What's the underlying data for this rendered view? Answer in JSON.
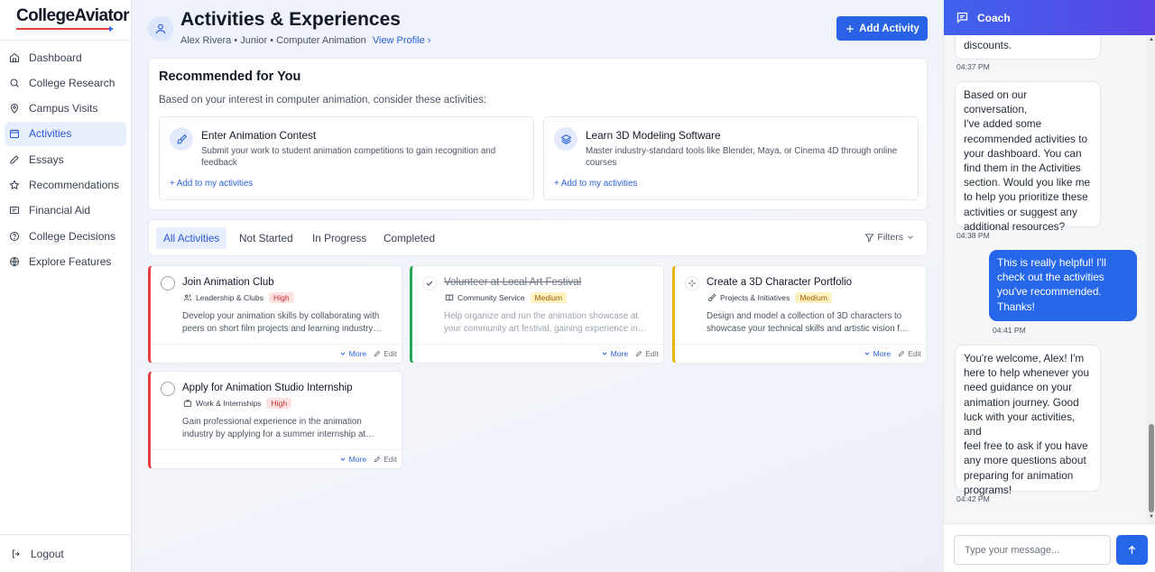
{
  "brand": {
    "name": "CollegeAviator"
  },
  "sidebar": {
    "items": [
      {
        "label": "Dashboard",
        "icon": "home-icon"
      },
      {
        "label": "College Research",
        "icon": "search-icon"
      },
      {
        "label": "Campus Visits",
        "icon": "map-pin-icon"
      },
      {
        "label": "Activities",
        "icon": "calendar-icon",
        "active": true
      },
      {
        "label": "Essays",
        "icon": "pencil-icon"
      },
      {
        "label": "Recommendations",
        "icon": "star-icon"
      },
      {
        "label": "Financial Aid",
        "icon": "dollar-icon"
      },
      {
        "label": "College Decisions",
        "icon": "help-circle-icon"
      },
      {
        "label": "Explore Features",
        "icon": "globe-icon"
      }
    ],
    "logout_label": "Logout"
  },
  "header": {
    "title": "Activities & Experiences",
    "subtitle": "Alex Rivera • Junior • Computer Animation",
    "view_profile": "View Profile",
    "add_button": "Add Activity"
  },
  "recommended": {
    "title": "Recommended for You",
    "subtitle": "Based on your interest in computer animation, consider these activities:",
    "cards": [
      {
        "title": "Enter Animation Contest",
        "description": "Submit your work to student animation competitions to gain recognition and feedback",
        "link": "+ Add to my activities",
        "icon": "brush-icon"
      },
      {
        "title": "Learn 3D Modeling Software",
        "description": "Master industry-standard tools like Blender, Maya, or Cinema 4D through online courses",
        "link": "+ Add to my activities",
        "icon": "layers-icon"
      }
    ]
  },
  "tabs": [
    "All Activities",
    "Not Started",
    "In Progress",
    "Completed"
  ],
  "filters_label": "Filters",
  "activities": [
    {
      "title": "Join Animation Club",
      "category": "Leadership & Clubs",
      "priority": "High",
      "description": "Develop your animation skills by collaborating with peers on short film projects and learning industry…",
      "status": "not-started",
      "accent": "#e53e3e"
    },
    {
      "title": "Volunteer at Local Art Festival",
      "category": "Community Service",
      "priority": "Medium",
      "description": "Help organize and run the animation showcase at your community art festival, gaining experience in…",
      "status": "completed",
      "accent": "#22a652"
    },
    {
      "title": "Create a 3D Character Portfolio",
      "category": "Projects & Initiatives",
      "priority": "Medium",
      "description": "Design and model a collection of 3D characters to showcase your technical skills and artistic vision f…",
      "status": "in-progress",
      "accent": "#eab308"
    },
    {
      "title": "Apply for Animation Studio Internship",
      "category": "Work & Internships",
      "priority": "High",
      "description": "Gain professional experience in the animation industry by applying for a summer internship at…",
      "status": "not-started",
      "accent": "#e53e3e"
    }
  ],
  "card_actions": {
    "more": "More",
    "edit": "Edit"
  },
  "coach": {
    "title": "Coach",
    "messages": [
      {
        "from": "coach",
        "lines": [
          "discounts."
        ],
        "time": "04:37 PM"
      },
      {
        "from": "coach",
        "lines": [
          "Based on our conversation,",
          "I've added some",
          "recommended activities to",
          "your dashboard. You can",
          "find them in the Activities",
          "section. Would you like me",
          "to help you prioritize these",
          "activities or suggest any",
          "additional resources?"
        ],
        "time": "04:38 PM"
      },
      {
        "from": "user",
        "lines": [
          "This is really helpful! I'll",
          "check out the activities",
          "you've recommended.",
          "Thanks!"
        ],
        "time": "04:41 PM"
      },
      {
        "from": "coach",
        "lines": [
          "You're welcome, Alex! I'm",
          "here to help whenever you",
          "need guidance on your",
          "animation journey. Good",
          "luck with your activities, and",
          "feel free to ask if you have",
          "any more questions about",
          "preparing for animation",
          "programs!"
        ],
        "time": "04:42 PM"
      }
    ],
    "input_placeholder": "Type your message..."
  },
  "colors": {
    "accent": "#2962e6",
    "high": "#e53e3e",
    "medium": "#eab308",
    "done": "#22a652"
  }
}
